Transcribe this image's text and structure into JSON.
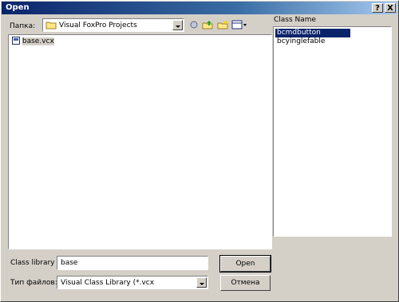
{
  "window": {
    "title": "Open",
    "help_label": "?",
    "close_label": "X"
  },
  "lookin": {
    "label": "Папка:",
    "value": "Visual FoxPro Projects",
    "folder_icon": "folder-icon"
  },
  "toolbar": {
    "back_icon": "back-icon",
    "up_icon": "up-folder-icon",
    "new_folder_icon": "new-folder-icon",
    "view_icon": "view-menu-icon"
  },
  "files": [
    {
      "name": "base.vcx"
    }
  ],
  "classes": {
    "header": "Class Name",
    "items": [
      "bcmdbutton",
      "bcyinglefable"
    ]
  },
  "footer": {
    "classlib_label": "Class library",
    "classlib_value": "base",
    "filetype_label": "Тип файлов:",
    "filetype_value": "Visual Class Library (*.vcx",
    "open_label": "Open",
    "cancel_label": "Отмена"
  }
}
